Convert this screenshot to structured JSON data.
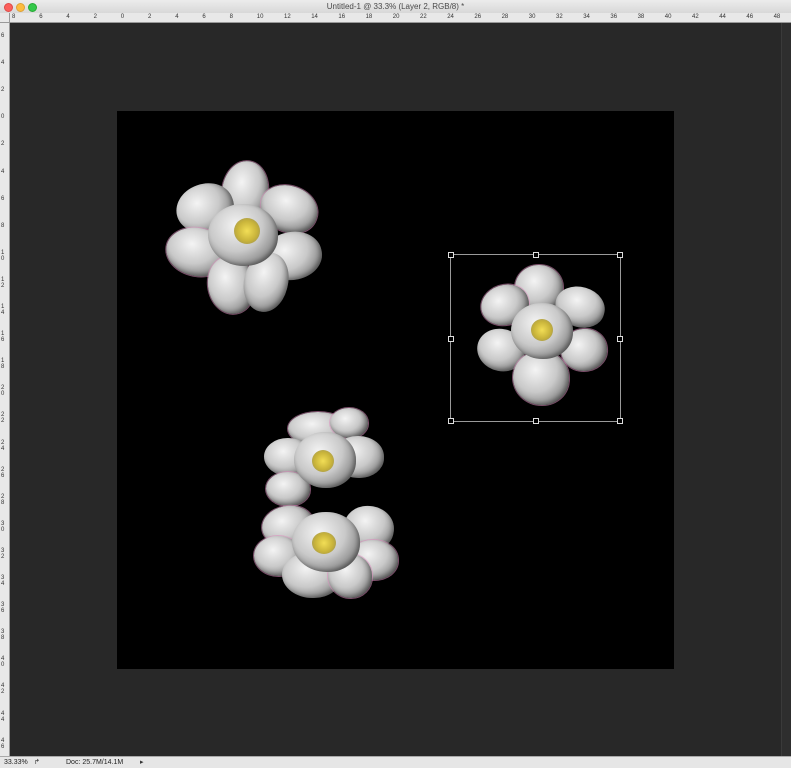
{
  "window": {
    "title": "Untitled-1 @ 33.3% (Layer 2, RGB/8) *"
  },
  "ruler_h": [
    "8",
    "6",
    "4",
    "2",
    "0",
    "2",
    "4",
    "6",
    "8",
    "10",
    "12",
    "14",
    "16",
    "18",
    "20",
    "22",
    "24",
    "26",
    "28",
    "30",
    "32",
    "34",
    "36",
    "38",
    "40",
    "42",
    "44",
    "46",
    "48"
  ],
  "ruler_v": [
    "6",
    "4",
    "2",
    "0",
    "2",
    "4",
    "6",
    "8",
    "1 0",
    "1 2",
    "1 4",
    "1 6",
    "1 8",
    "2 0",
    "2 2",
    "2 4",
    "2 6",
    "2 8",
    "3 0",
    "3 2",
    "3 4",
    "3 6",
    "3 8",
    "4 0",
    "4 2",
    "4 4",
    "4 6",
    "4 8"
  ],
  "statusbar": {
    "zoom": "33.33%",
    "share_icon": "share-icon",
    "doc_info": "Doc: 25.7M/14.1M",
    "menu_arrow": "▸"
  },
  "colors": {
    "canvas_bg": "#000000",
    "workspace": "#282828",
    "petal_tint": "#dc8cbe",
    "stamen": "#e8d44a"
  }
}
